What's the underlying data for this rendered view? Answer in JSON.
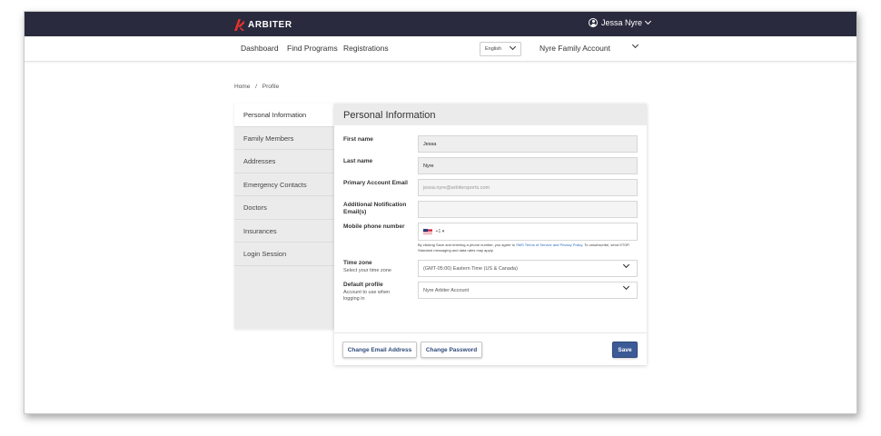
{
  "brand": {
    "name": "ARBITER",
    "logo_color": "#e8322b"
  },
  "user": {
    "name": "Jessa Nyre"
  },
  "nav": {
    "links": [
      "Dashboard",
      "Find Programs",
      "Registrations"
    ],
    "language": "English",
    "account": "Nyre Family Account"
  },
  "breadcrumb": {
    "home": "Home",
    "separator": "/",
    "current": "Profile"
  },
  "sidebar": {
    "items": [
      {
        "label": "Personal Information",
        "active": true
      },
      {
        "label": "Family Members"
      },
      {
        "label": "Addresses"
      },
      {
        "label": "Emergency Contacts"
      },
      {
        "label": "Doctors"
      },
      {
        "label": "Insurances"
      },
      {
        "label": "Login Session"
      }
    ]
  },
  "panel": {
    "title": "Personal Information",
    "first_name": {
      "label": "First name",
      "value": "Jessa"
    },
    "last_name": {
      "label": "Last name",
      "value": "Nyre"
    },
    "email": {
      "label": "Primary Account Email",
      "value": "jessa.nyre@arbitersports.com"
    },
    "additional_email": {
      "label": "Additional Notification Email(s)",
      "value": ""
    },
    "mobile": {
      "label": "Mobile phone number",
      "country_code": "+1",
      "flag": "us-flag-icon"
    },
    "consent": {
      "prefix": "By clicking Save and entering a phone number, you agree to",
      "link": "SMS Terms of Service and Privacy Policy",
      "suffix": ". To unsubscribe, send STOP. Standard messaging and data rates may apply."
    },
    "timezone": {
      "label": "Time zone",
      "sublabel": "Select your time zone",
      "value": "(GMT-05:00) Eastern Time (US & Canada)"
    },
    "default_profile": {
      "label": "Default profile",
      "sublabel": "Account to use when logging in",
      "value": "Nyre Arbiter Account"
    }
  },
  "actions": {
    "change_email": "Change Email Address",
    "change_password": "Change Password",
    "save": "Save"
  },
  "colors": {
    "topbar": "#2a2a3e",
    "primary_button": "#3c5a96",
    "link": "#2a6bbf"
  }
}
